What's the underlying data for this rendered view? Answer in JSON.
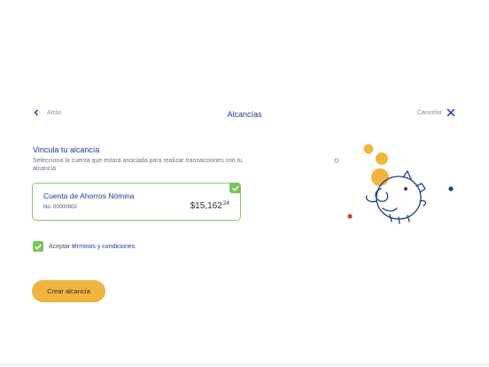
{
  "header": {
    "back_label": "Atrás",
    "title": "Alcancías",
    "cancel_label": "Cancelar"
  },
  "link_section": {
    "title": "Vincula tu alcancía",
    "description": "Selecciona la cuenta que estará asociada para realizar transacciones con tu alcancía"
  },
  "account": {
    "name": "Cuenta de Ahorros Nómina",
    "number": "No. 00000002",
    "balance_main": "$15,162",
    "balance_cents": "24",
    "selected": true
  },
  "terms": {
    "prefix": "Aceptar",
    "link": "términos y condiciones",
    "checked": true
  },
  "create_button": {
    "label": "Crear alcancía"
  },
  "colors": {
    "primary_blue": "#1e3c8f",
    "accent_green": "#7cc45a",
    "button_yellow": "#f2b441",
    "coin_yellow": "#f2b441",
    "dot_red": "#c8463a"
  },
  "icons": {
    "back": "chevron-left-icon",
    "cancel": "close-icon",
    "card_check": "check-icon",
    "illustration": "piggy-bank-illustration"
  }
}
